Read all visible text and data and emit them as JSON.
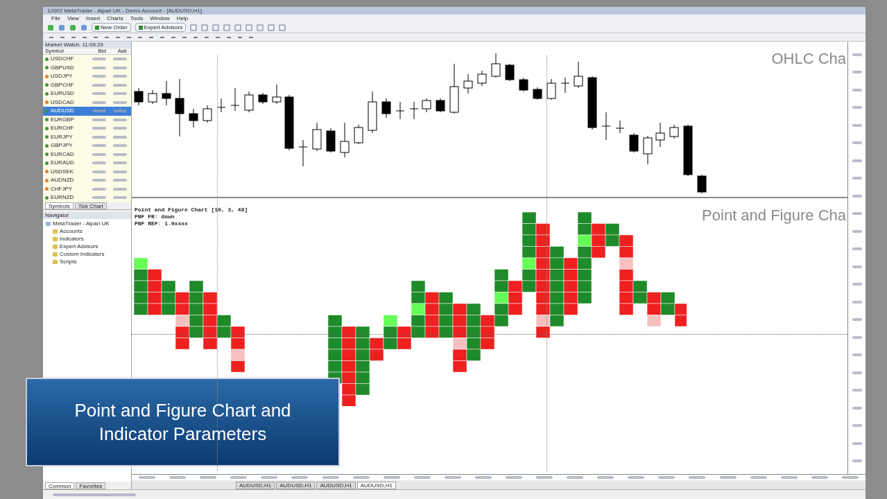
{
  "window": {
    "title": "12002 MetaTrader - Alpari UK - Demo Account - [AUDUSD,H1]"
  },
  "menu": [
    "File",
    "View",
    "Insert",
    "Charts",
    "Tools",
    "Window",
    "Help"
  ],
  "toolbar": {
    "buttons": [
      "New Order",
      "Expert Advisors"
    ]
  },
  "market_watch": {
    "title": "Market Watch: 11:09:29",
    "columns": [
      "Symbol",
      "Bid",
      "Ask"
    ],
    "rows": [
      {
        "symbol": "USDCHF",
        "selected": false,
        "color": "#3a9a3a"
      },
      {
        "symbol": "GBPUSD",
        "selected": false,
        "color": "#3a9a3a"
      },
      {
        "symbol": "USDJPY",
        "selected": false,
        "color": "#e08020"
      },
      {
        "symbol": "GBPCHF",
        "selected": false,
        "color": "#3a9a3a"
      },
      {
        "symbol": "EURUSD",
        "selected": false,
        "color": "#3a9a3a"
      },
      {
        "symbol": "USDCAD",
        "selected": false,
        "color": "#e08020"
      },
      {
        "symbol": "AUDUSD",
        "selected": true,
        "color": "#3a9a3a"
      },
      {
        "symbol": "EURGBP",
        "selected": false,
        "color": "#3a9a3a"
      },
      {
        "symbol": "EURCHF",
        "selected": false,
        "color": "#3a9a3a"
      },
      {
        "symbol": "EURJPY",
        "selected": false,
        "color": "#3a9a3a"
      },
      {
        "symbol": "GBPJPY",
        "selected": false,
        "color": "#3a9a3a"
      },
      {
        "symbol": "EURCAD",
        "selected": false,
        "color": "#3a9a3a"
      },
      {
        "symbol": "EURAUD",
        "selected": false,
        "color": "#3a9a3a"
      },
      {
        "symbol": "USDSEK",
        "selected": false,
        "color": "#e08020"
      },
      {
        "symbol": "AUDNZD",
        "selected": false,
        "color": "#e08020"
      },
      {
        "symbol": "CHFJPY",
        "selected": false,
        "color": "#e08020"
      },
      {
        "symbol": "EURNZD",
        "selected": false,
        "color": "#3a9a3a"
      }
    ],
    "tabs": [
      {
        "label": "Symbols",
        "selected": true
      },
      {
        "label": "Tick Chart",
        "selected": false
      }
    ]
  },
  "navigator": {
    "title": "Navigator",
    "items": [
      {
        "label": "MetaTrader - Alpari UK",
        "children": [
          {
            "label": "Accounts"
          },
          {
            "label": "Indicators"
          },
          {
            "label": "Expert Advisors"
          },
          {
            "label": "Custom Indicators"
          },
          {
            "label": "Scripts"
          }
        ]
      }
    ],
    "tabs": [
      {
        "label": "Common",
        "selected": true
      },
      {
        "label": "Favorites",
        "selected": false
      }
    ]
  },
  "ohlc_chart": {
    "watermark": "OHLC Cha"
  },
  "pnf_chart": {
    "watermark": "Point and Figure Cha",
    "legend": [
      "Point and Figure Chart [10, 3, 48]",
      "PNF FR: down",
      "PNF REF: 1.0xxxx"
    ]
  },
  "chart_tabs": [
    {
      "label": "AUDUSD,H1",
      "selected": false
    },
    {
      "label": "AUDUSD,H1",
      "selected": false
    },
    {
      "label": "AUDUSD,H1",
      "selected": false
    },
    {
      "label": "AUDUSD,H1",
      "selected": true
    }
  ],
  "banner": {
    "text": "Point and Figure Chart and Indicator Parameters"
  }
}
